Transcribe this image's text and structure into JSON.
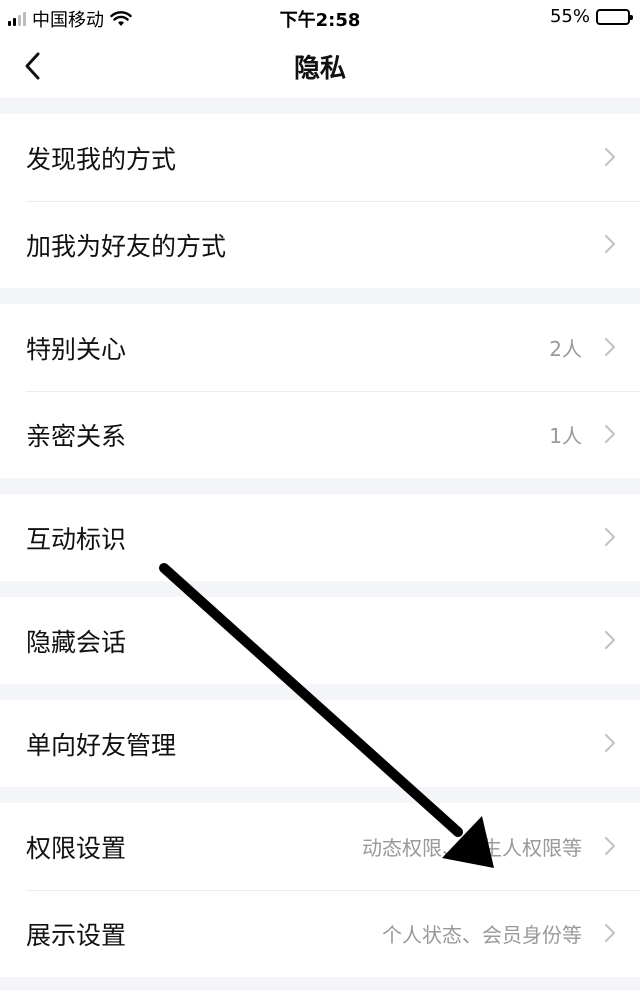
{
  "status_bar": {
    "carrier": "中国移动",
    "time": "下午2:58",
    "battery_percent": "55%",
    "battery_level": 0.55
  },
  "nav": {
    "title": "隐私"
  },
  "groups": [
    [
      {
        "label": "发现我的方式",
        "value": ""
      },
      {
        "label": "加我为好友的方式",
        "value": ""
      }
    ],
    [
      {
        "label": "特别关心",
        "value": "2人"
      },
      {
        "label": "亲密关系",
        "value": "1人"
      }
    ],
    [
      {
        "label": "互动标识",
        "value": ""
      }
    ],
    [
      {
        "label": "隐藏会话",
        "value": ""
      }
    ],
    [
      {
        "label": "单向好友管理",
        "value": ""
      }
    ],
    [
      {
        "label": "权限设置",
        "value": "动态权限、陌生人权限等"
      },
      {
        "label": "展示设置",
        "value": "个人状态、会员身份等"
      }
    ]
  ]
}
